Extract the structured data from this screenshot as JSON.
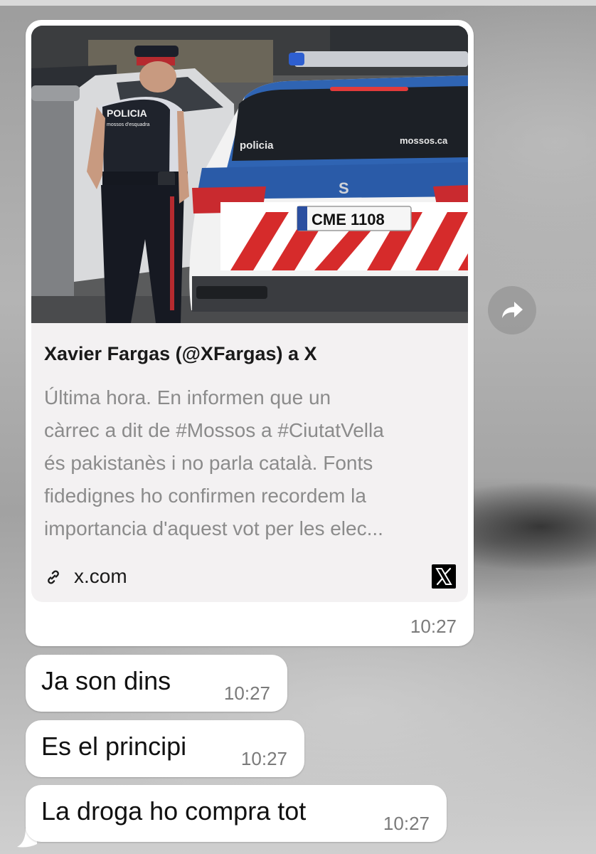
{
  "link_preview": {
    "title": "Xavier Fargas (@XFargas) a X",
    "description_lines": [
      "Última hora. En informen que un",
      "càrrec a dit de #Mossos a #CiutatVella",
      "és pakistanès i no parla català. Fonts",
      "fidedignes ho confirmen recordem la",
      "importancia d'aquest vot per les elec..."
    ],
    "domain": "x.com",
    "time": "10:27",
    "image": {
      "officer_vest_text": "POLICIA",
      "officer_vest_subtext": "mossos d'esquadra",
      "window_text_left": "policia",
      "window_text_right": "mossos.ca",
      "plate": "CME 1108",
      "car_badge": "S"
    }
  },
  "messages": [
    {
      "text": "Ja son dins",
      "time": "10:27"
    },
    {
      "text": "Es el principi",
      "time": "10:27"
    },
    {
      "text": "La droga ho compra tot",
      "time": "10:27"
    }
  ],
  "icons": {
    "forward": "forward-arrow-icon",
    "link": "link-icon",
    "x_logo": "x-logo-icon"
  }
}
